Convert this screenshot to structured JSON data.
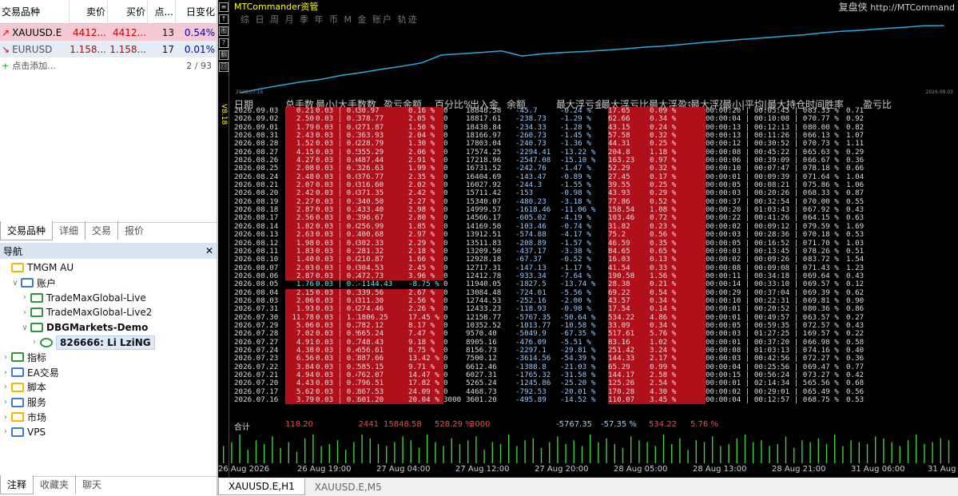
{
  "market_watch": {
    "headers": [
      "交易品种",
      "卖价",
      "买价",
      "点...",
      "日变化"
    ],
    "rows": [
      {
        "arrow": "↗",
        "symbol": "XAUUSD.E",
        "bid": "4412...",
        "ask": "4412...",
        "spread": "13",
        "change": "0.54%",
        "style": "up"
      },
      {
        "arrow": "↘",
        "symbol": "EURUSD",
        "bid": "1.158...",
        "ask": "1.158...",
        "spread": "17",
        "change": "0.01%",
        "style": "down"
      }
    ],
    "add_label": "点击添加...",
    "count": "2 / 93",
    "tabs": [
      "交易品种",
      "详细",
      "交易",
      "报价"
    ]
  },
  "navigator": {
    "title": "导航",
    "close": "✕",
    "items": [
      {
        "label": "TMGM AU",
        "indent": 0,
        "icon": "broker-icon",
        "arrow": ""
      },
      {
        "label": "账户",
        "indent": 1,
        "icon": "accounts-icon",
        "arrow": "∨"
      },
      {
        "label": "TradeMaxGlobal-Live",
        "indent": 2,
        "icon": "server-icon",
        "arrow": "›"
      },
      {
        "label": "TradeMaxGlobal-Live2",
        "indent": 2,
        "icon": "server-icon",
        "arrow": "›"
      },
      {
        "label": "DBGMarkets-Demo",
        "indent": 2,
        "icon": "server-icon",
        "arrow": "∨",
        "bold": true
      },
      {
        "label": "826666: Li LziNG",
        "indent": 3,
        "icon": "user-icon",
        "arrow": "›",
        "bold": true,
        "selected": true
      },
      {
        "label": "指标",
        "indent": 0,
        "icon": "indicator-icon",
        "arrow": "›"
      },
      {
        "label": "EA交易",
        "indent": 0,
        "icon": "ea-icon",
        "arrow": "›"
      },
      {
        "label": "脚本",
        "indent": 0,
        "icon": "script-icon",
        "arrow": "›"
      },
      {
        "label": "服务",
        "indent": 0,
        "icon": "service-icon",
        "arrow": "›"
      },
      {
        "label": "市场",
        "indent": 0,
        "icon": "market-icon",
        "arrow": "›"
      },
      {
        "label": "VPS",
        "indent": 0,
        "icon": "vps-icon",
        "arrow": "›"
      }
    ],
    "bottom_tabs": [
      "注释",
      "收藏夹",
      "聊天"
    ]
  },
  "chart_panel": {
    "title": "MTCommander资管",
    "menu": "综 日 周 月 季 年 币 M 金 账户        轨迹",
    "right_link_a": "复盘侠",
    "right_link_b": "http://MTCommand",
    "eq_start_label": "2026.07.16",
    "eq_end_label": "2026.09.03",
    "headers": [
      "日期",
      "总手数",
      "最小|大手数数",
      "盈亏金额",
      "百分比%",
      "出入金",
      "余额",
      "最大浮亏金额",
      "最大浮亏比",
      "最大浮盈金额",
      "最大浮盈比",
      "最小|平均|最大持仓时间",
      "胜率",
      "盈亏比"
    ],
    "side_label": "V8.18",
    "rows": [
      [
        "2026.09.03",
        "0.21",
        "0.03 | 0.05 | 6",
        "30.97",
        "0.16 %",
        "0",
        "18848.58",
        "-45.7",
        "-0.24 %",
        "17.65",
        "0.09 %",
        "00:00:20 | 00:05:45 | 00:14:23",
        "83.33 %",
        "0.71",
        "pos"
      ],
      [
        "2026.09.02",
        "2.50",
        "0.03 | 0.11 | 66",
        "378.77",
        "2.05 %",
        "0",
        "18817.61",
        "-238.73",
        "-1.29 %",
        "62.66",
        "0.34 %",
        "00:00:04 | 00:10:08 | 00:42:14",
        "70.77 %",
        "0.92",
        "pos"
      ],
      [
        "2026.09.01",
        "1.79",
        "0.03 | 0.09 | 50",
        "271.87",
        "1.50 %",
        "0",
        "18438.84",
        "-234.33",
        "-1.28 %",
        "43.15",
        "0.24 %",
        "00:00:13 | 00:12:13 | 00:45:42",
        "80.00 %",
        "0.82",
        "pos"
      ],
      [
        "2026.08.31",
        "2.43",
        "0.03 | 0.11 | 52",
        "363.93",
        "2.04 %",
        "0",
        "18166.97",
        "-260.73",
        "-1.45 %",
        "57.58",
        "0.32 %",
        "00:00:13 | 00:11:26 | 00:55:13",
        "66.13 %",
        "1.07",
        "pos"
      ],
      [
        "2026.08.28",
        "1.52",
        "0.03 | 0.09 | 41",
        "228.79",
        "1.30 %",
        "0",
        "17803.04",
        "-240.73",
        "-1.36 %",
        "44.31",
        "0.25 %",
        "00:00:12 | 00:30:52 | 02:08:50",
        "70.73 %",
        "1.11",
        "pos"
      ],
      [
        "2026.08.27",
        "4.15",
        "0.03 | 0.54 | 64",
        "355.29",
        "2.06 %",
        "0",
        "17574.25",
        "-2294.41",
        "-13.22 %",
        "204.8",
        "1.18 %",
        "00:00:08 | 00:45:22 | 04:38:10",
        "65.63 %",
        "0.29",
        "pos"
      ],
      [
        "2026.08.26",
        "4.27",
        "0.03 | 0.64 | 66",
        "487.44",
        "2.91 %",
        "0",
        "17218.96",
        "-2547.08",
        "-15.10 %",
        "163.23",
        "0.97 %",
        "00:00:06 | 00:39:09 | 03:59:18",
        "66.67 %",
        "0.36",
        "pos"
      ],
      [
        "2026.08.25",
        "2.08",
        "0.03 | 0.11 | 55",
        "326.63",
        "1.99 %",
        "0",
        "16731.52",
        "-242.76",
        "-1.47 %",
        "52.29",
        "0.32 %",
        "00:00:10 | 00:07:47 | 00:44:06",
        "78.18 %",
        "0.66",
        "pos"
      ],
      [
        "2026.08.24",
        "2.48",
        "0.03 | 0.07 | 67",
        "376.77",
        "2.35 %",
        "0",
        "16404.69",
        "-143.47",
        "-0.89 %",
        "27.45",
        "0.17 %",
        "00:00:01 | 00:09:39 | 01:07:23",
        "71.64 %",
        "1.04",
        "pos"
      ],
      [
        "2026.08.21",
        "2.07",
        "0.03 | 0.09 | 58",
        "316.60",
        "2.02 %",
        "0",
        "16027.92",
        "-244.3",
        "-1.55 %",
        "39.55",
        "0.25 %",
        "00:00:05 | 00:08:21 | 01:05:53",
        "75.86 %",
        "1.06",
        "pos"
      ],
      [
        "2026.08.20",
        "2.42",
        "0.03 | 0.09 | 60",
        "371.35",
        "2.42 %",
        "0",
        "15711.42",
        "-153",
        "-0.98 %",
        "43.93",
        "0.29 %",
        "00:00:03 | 00:20:26 | 01:20:38",
        "68.33 %",
        "0.87",
        "pos"
      ],
      [
        "2026.08.19",
        "2.27",
        "0.03 | 0.14 | 50",
        "340.50",
        "2.27 %",
        "0",
        "15340.07",
        "-480.23",
        "-3.18 %",
        "77.86",
        "0.52 %",
        "00:00:37 | 00:32:54 | 02:33:52",
        "70.00 %",
        "0.55",
        "pos"
      ],
      [
        "2026.08.18",
        "2.87",
        "0.03 | 0.32 | 53",
        "433.40",
        "2.98 %",
        "0",
        "14999.57",
        "-1618.46",
        "-11.06 %",
        "158.54",
        "1.08 %",
        "00:00:20 | 01:03:43 | 04:55:07",
        "67.92 %",
        "0.43",
        "pos"
      ],
      [
        "2026.08.17",
        "2.56",
        "0.03 | 0.19 | 63",
        "396.67",
        "2.80 %",
        "0",
        "14566.17",
        "-605.02",
        "-4.19 %",
        "103.46",
        "0.72 %",
        "00:00:22 | 00:41:26 | 02:44:36",
        "64.15 %",
        "0.63",
        "pos"
      ],
      [
        "2026.08.14",
        "1.82",
        "0.03 | 0.07 | 49",
        "256.99",
        "1.85 %",
        "0",
        "14169.50",
        "-103.46",
        "-0.74 %",
        "31.82",
        "0.23 %",
        "00:00:02 | 00:09:12 | 01:00:43",
        "79.59 %",
        "1.69",
        "pos"
      ],
      [
        "2026.08.13",
        "2.63",
        "0.03 | 0.19 | 57",
        "400.68",
        "2.97 %",
        "0",
        "13912.51",
        "-574.88",
        "-4.17 %",
        "75.2",
        "0.56 %",
        "00:00:03 | 00:28:36 | 03:16:52",
        "70.18 %",
        "0.53",
        "pos"
      ],
      [
        "2026.08.12",
        "1.98",
        "0.03 | 0.09 | 53",
        "302.33",
        "2.29 %",
        "0",
        "13511.83",
        "-208.89",
        "-1.57 %",
        "46.59",
        "0.35 %",
        "00:00:05 | 00:16:52 | 01:53:02",
        "71.70 %",
        "1.03",
        "pos"
      ],
      [
        "2026.08.11",
        "1.83",
        "0.03 | 0.14 | 46",
        "281.32",
        "2.18 %",
        "0",
        "13209.50",
        "-437.17",
        "-3.38 %",
        "84.65",
        "0.65 %",
        "00:00:03 | 00:13:45 | 01:00:21",
        "78.26 %",
        "0.51",
        "pos"
      ],
      [
        "2026.08.10",
        "1.40",
        "0.03 | 0.05 | 43",
        "210.87",
        "1.66 %",
        "0",
        "12928.18",
        "-67.37",
        "-0.52 %",
        "16.03",
        "0.13 %",
        "00:00:02 | 00:09:26 | 00:48:08",
        "83.72 %",
        "1.54",
        "pos"
      ],
      [
        "2026.08.07",
        "2.03",
        "0.03 | 0.09 | 56",
        "304.53",
        "2.45 %",
        "0",
        "12717.31",
        "-147.13",
        "-1.17 %",
        "41.54",
        "0.33 %",
        "00:00:08 | 00:09:08 | 00:55:51",
        "71.43 %",
        "1.23",
        "pos"
      ],
      [
        "2026.08.06",
        "2.87",
        "0.03 | 0.24 | 56",
        "472.73",
        "3.96 %",
        "0",
        "12412.78",
        "-933.34",
        "-7.64 %",
        "190.58",
        "1.56 %",
        "00:00:11 | 00:34:18 | 03:00:36",
        "69.64 %",
        "0.43",
        "pos"
      ],
      [
        "2026.08.05",
        "1.76",
        "0.03 | 0.11 | 46",
        "-1144.43",
        "-8.75 %",
        "0",
        "11940.05",
        "-1827.5",
        "-13.74 %",
        "28.38",
        "0.21 %",
        "00:00:14 | 00:33:10 | 03:01:05",
        "69.57 %",
        "0.12",
        "neg"
      ],
      [
        "2026.08.04",
        "2.15",
        "0.03 | 0.11 | 49",
        "339.56",
        "2.67 %",
        "0",
        "13084.48",
        "-724.01",
        "-5.56 %",
        "69.22",
        "0.54 %",
        "00:00:29 | 00:37:04 | 02:32:04",
        "69.39 %",
        "0.62",
        "pos"
      ],
      [
        "2026.08.03",
        "2.06",
        "0.03 | 0.09 | 53",
        "311.30",
        "2.56 %",
        "0",
        "12744.53",
        "-252.16",
        "-2.00 %",
        "43.57",
        "0.34 %",
        "00:00:10 | 00:22:31 | 01:29:35",
        "69.81 %",
        "0.90",
        "pos"
      ],
      [
        "2026.07.31",
        "1.93",
        "0.03 | 0.09 | 56",
        "274.46",
        "2.26 %",
        "0",
        "12433.23",
        "-118.93",
        "-0.98 %",
        "17.54",
        "0.14 %",
        "00:00:01 | 00:20:52 | 02:30:01",
        "80.36 %",
        "0.86",
        "pos"
      ],
      [
        "2026.07.30",
        "11.78",
        "0.03 | 1.17 | 129",
        "1806.25",
        "17.45 %",
        "0",
        "12158.77",
        "-5767.35",
        "-50.64 %",
        "534.22",
        "4.86 %",
        "00:00:01 | 00:49:57 | 04:53:00",
        "63.57 %",
        "0.27",
        "pos"
      ],
      [
        "2026.07.29",
        "5.06",
        "0.03 | 0.24 | 113",
        "782.12",
        "8.17 %",
        "0",
        "10352.52",
        "-1013.77",
        "-10.58 %",
        "33.09",
        "0.34 %",
        "00:00:05 | 00:59:35 | 07:38:04",
        "72.57 %",
        "0.43",
        "pos"
      ],
      [
        "2026.07.28",
        "7.02",
        "0.03 | 0.91 | 92",
        "665.24",
        "7.47 %",
        "0",
        "9570.40",
        "-5049.9",
        "-67.35 %",
        "517.61",
        "5.76 %",
        "00:00:03 | 01:27:25 | 10:52:33",
        "69.57 %",
        "0.22",
        "pos"
      ],
      [
        "2026.07.27",
        "4.91",
        "0.03 | 0.14 | 106",
        "748.43",
        "9.18 %",
        "0",
        "8905.16",
        "-476.09",
        "-5.51 %",
        "83.16",
        "1.02 %",
        "00:00:01 | 00:37:20 | 02:53:15",
        "66.98 %",
        "0.58",
        "pos"
      ],
      [
        "2026.07.24",
        "4.38",
        "0.03 | 0.41 | 69",
        "656.61",
        "8.75 %",
        "0",
        "8156.73",
        "-2297.1",
        "-29.81 %",
        "251.42",
        "3.24 %",
        "00:00:08 | 01:03:13 | 07:06:51",
        "74.16 %",
        "0.40",
        "pos"
      ],
      [
        "2026.07.23",
        "6.56",
        "0.03 | 0.70 | 119",
        "887.66",
        "13.42 %",
        "0",
        "7500.12",
        "-3614.56",
        "-54.39 %",
        "144.33",
        "2.17 %",
        "00:00:03 | 00:42:56 | 07:52:01",
        "72.27 %",
        "0.36",
        "pos"
      ],
      [
        "2026.07.22",
        "3.84",
        "0.03 | 0.14 | 95",
        "585.15",
        "9.71 %",
        "0",
        "6612.46",
        "-1388.8",
        "-21.03 %",
        "65.29",
        "0.99 %",
        "00:00:04 | 00:25:56 | 02:12:45",
        "69.47 %",
        "0.77",
        "pos"
      ],
      [
        "2026.07.21",
        "4.94",
        "0.03 | 0.41 | 101",
        "762.07",
        "14.47 %",
        "0",
        "6027.31",
        "-1765.32",
        "-31.58 %",
        "144.17",
        "2.58 %",
        "00:00:15 | 00:56:24 | 07:16:06",
        "73.27 %",
        "0.42",
        "pos"
      ],
      [
        "2026.07.20",
        "4.43",
        "0.03 | 0.32 | 90",
        "796.51",
        "17.82 %",
        "0",
        "5265.24",
        "-1245.86",
        "-25.20 %",
        "125.26",
        "2.54 %",
        "00:00:01 | 02:14:34 | 50:34:47",
        "65.56 %",
        "0.68",
        "pos"
      ],
      [
        "2026.07.17",
        "5.62",
        "0.03 | 0.32 | 113",
        "867.53",
        "24.09 %",
        "0",
        "4468.73",
        "-792.53",
        "-20.01 %",
        "170.28",
        "4.30 %",
        "00:00:02 | 00:29:01 | 04:05:46",
        "65.49 %",
        "0.56",
        "pos"
      ],
      [
        "2026.07.16",
        "3.79",
        "0.03 | 0.19 | 80",
        "601.20",
        "20.04 %",
        "3000",
        "3601.20",
        "-495.89",
        "-14.52 %",
        "110.07",
        "3.45 %",
        "00:00:04 | 00:12:57 | 01:07:13",
        "68.75 %",
        "0.53",
        "pos"
      ]
    ],
    "total": {
      "label": "合计",
      "lots": "118.20",
      "count": "2441",
      "pnl": "15848.58",
      "pct": "528.29 %",
      "inout": "3000",
      "fl": "-5767.35",
      "flp": "-57.35 %",
      "fg": "534.22",
      "fgp": "5.76 %"
    },
    "xaxis": [
      "26 Aug 2026",
      "26 Aug 19:00",
      "27 Aug 04:00",
      "27 Aug 12:00",
      "27 Aug 20:00",
      "28 Aug 05:00",
      "28 Aug 13:00",
      "28 Aug 21:00",
      "31 Aug 06:00",
      "31 Aug"
    ],
    "tabs": [
      "XAUUSD.E,H1",
      "XAUUSD.E,M5"
    ]
  },
  "colors": {
    "accent_red": "#b0101a",
    "equity_line": "#29a9e0",
    "bar_green": "#3ecf3e",
    "title_yellow": "#ffff00"
  }
}
